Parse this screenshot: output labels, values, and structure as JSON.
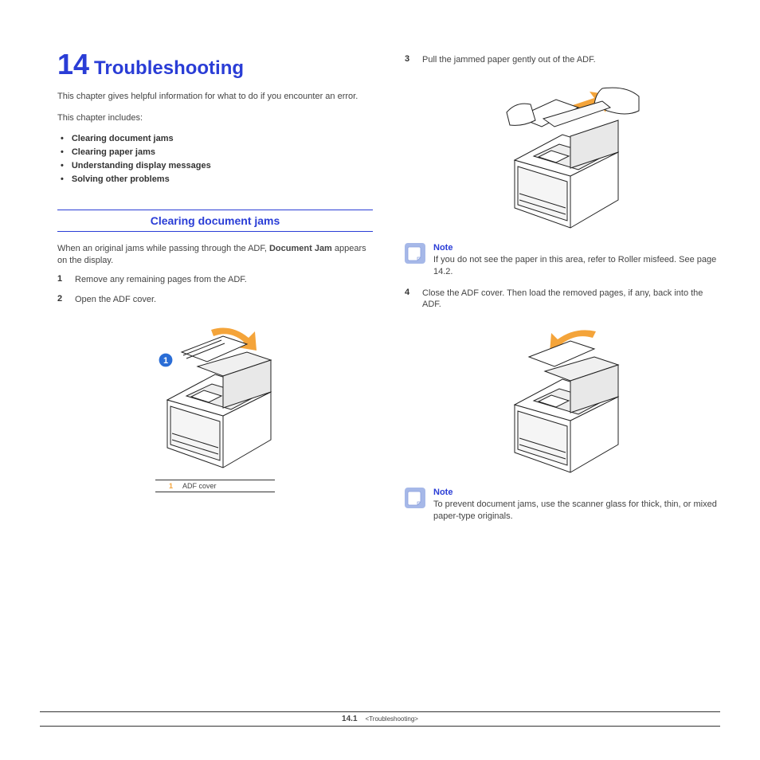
{
  "chapter": {
    "number": "14",
    "title": "Troubleshooting"
  },
  "intro1": "This chapter gives helpful information for what to do if you encounter an error.",
  "intro2": "This chapter includes:",
  "toc": [
    "Clearing document jams",
    "Clearing paper jams",
    "Understanding display messages",
    "Solving other problems"
  ],
  "section1": {
    "title": "Clearing document jams",
    "lead_pre": "When an original jams while passing through the ADF, ",
    "lead_bold": "Document Jam",
    "lead_post": " appears on the display."
  },
  "steps": {
    "s1": {
      "n": "1",
      "text": "Remove any remaining pages from the ADF."
    },
    "s2": {
      "n": "2",
      "text": "Open the ADF cover."
    },
    "s3": {
      "n": "3",
      "text": "Pull the jammed paper gently out of the ADF."
    },
    "s4": {
      "n": "4",
      "text": "Close the ADF cover. Then load the removed pages, if any, back into the ADF."
    }
  },
  "figure1_caption": {
    "n": "1",
    "label": "ADF cover"
  },
  "figure1_callout": "1",
  "note1": {
    "heading": "Note",
    "body": "If you do not see the paper in this area, refer to Roller misfeed. See page 14.2."
  },
  "note2": {
    "heading": "Note",
    "body": "To prevent document jams, use the scanner glass for thick, thin, or mixed paper-type originals."
  },
  "footer": {
    "page": "14.1",
    "title": "<Troubleshooting>"
  }
}
